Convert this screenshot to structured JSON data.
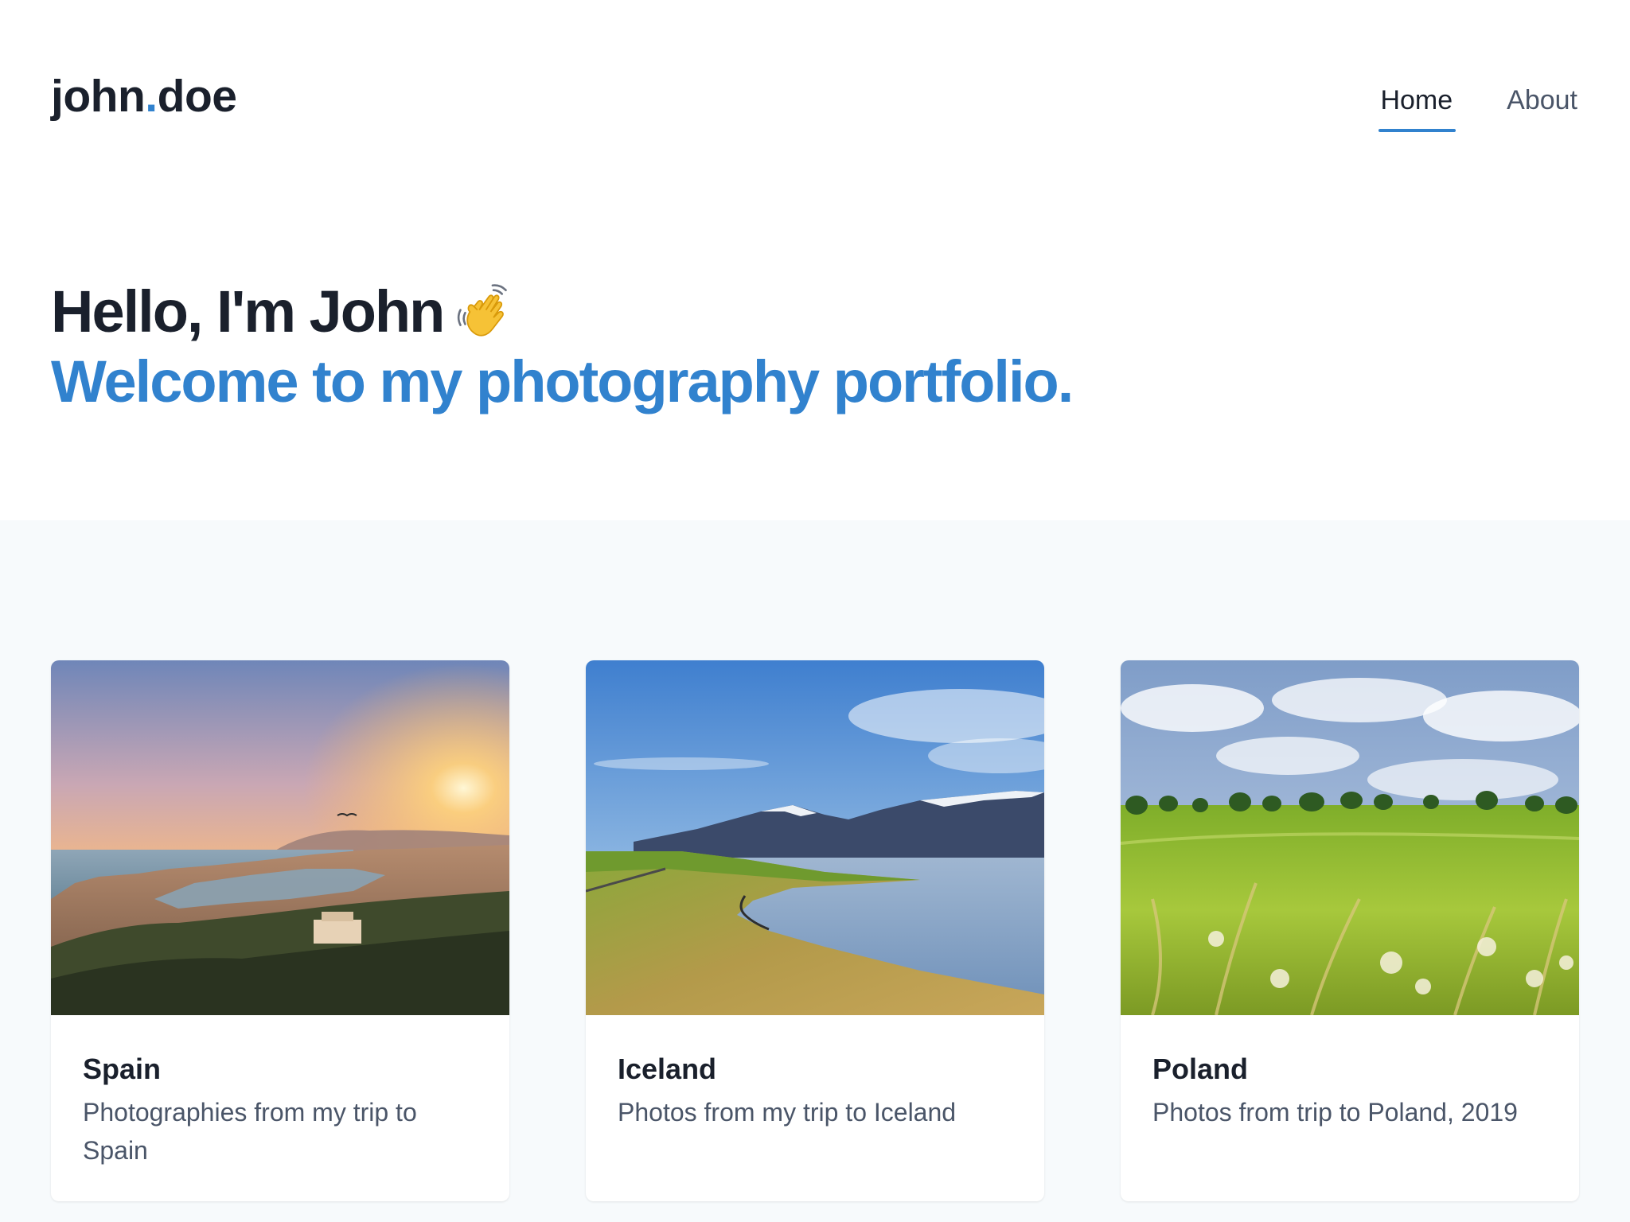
{
  "header": {
    "logo_first": "john",
    "logo_dot": ".",
    "logo_second": "doe",
    "nav": [
      {
        "label": "Home",
        "active": true
      },
      {
        "label": "About",
        "active": false
      }
    ]
  },
  "hero": {
    "greeting": "Hello, I'm John",
    "greeting_icon": "waving-hand-icon",
    "subtitle": "Welcome to my photography portfolio."
  },
  "gallery": {
    "cards": [
      {
        "title": "Spain",
        "description": "Photographies from my trip to Spain",
        "image": "sunset-coastal-city-photo"
      },
      {
        "title": "Iceland",
        "description": "Photos from my trip to Iceland",
        "image": "mountain-lake-landscape-photo"
      },
      {
        "title": "Poland",
        "description": "Photos from trip to Poland, 2019",
        "image": "green-meadow-landscape-photo"
      }
    ]
  },
  "colors": {
    "accent": "#3182ce",
    "text_dark": "#1a202c",
    "text_muted": "#4a5568",
    "section_bg": "#f7fafc"
  }
}
